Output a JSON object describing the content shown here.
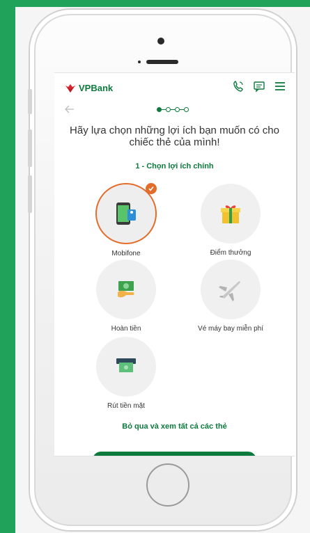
{
  "app": {
    "brand": "VPBank"
  },
  "header": {
    "icons": [
      "phone-icon",
      "chat-icon",
      "menu-icon"
    ]
  },
  "progress": {
    "current_step": 1,
    "total_steps": 4
  },
  "content": {
    "heading": "Hãy lựa chọn những lợi ích bạn muốn có cho chiếc thẻ của mình!",
    "step_label": "1 - Chọn lợi ích chính",
    "options": [
      {
        "label": "Mobifone",
        "icon": "phone-card-icon",
        "selected": true
      },
      {
        "label": "Điểm thưởng",
        "icon": "gift-icon",
        "selected": false
      },
      {
        "label": "Hoàn tiền",
        "icon": "cash-hand-icon",
        "selected": false
      },
      {
        "label": "Vé máy bay miễn phí",
        "icon": "airplane-icon",
        "selected": false
      },
      {
        "label": "Rút tiền mặt",
        "icon": "atm-cash-icon",
        "selected": false
      }
    ],
    "skip_link": "Bỏ qua và xem tất cả các thẻ"
  },
  "colors": {
    "brand_green": "#0d7a3d",
    "accent_orange": "#e46c2a",
    "background": "#21a25a"
  }
}
